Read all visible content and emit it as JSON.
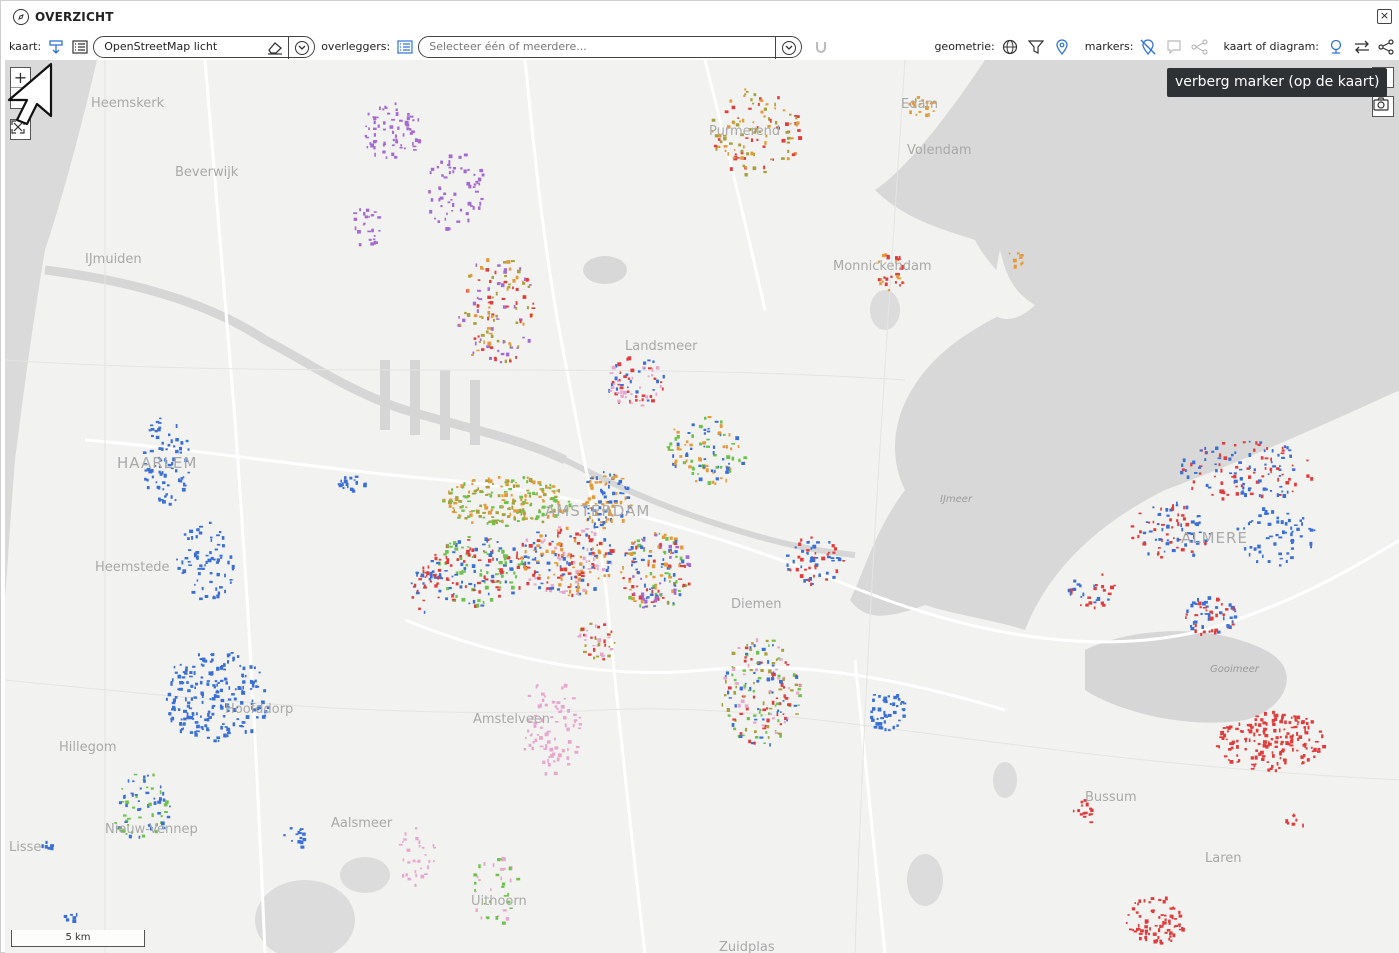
{
  "window": {
    "title": "OVERZICHT",
    "close_label": "×"
  },
  "toolbar": {
    "kaart_label": "kaart:",
    "basemap_value": "OpenStreetMap licht",
    "overlays_label": "overleggers:",
    "overlays_placeholder": "Selecteer één of meerdere...",
    "geometry_label": "geometrie:",
    "markers_label": "markers:",
    "map_or_chart_label": "kaart of diagram:"
  },
  "map": {
    "places": [
      {
        "name": "Heemskerk"
      },
      {
        "name": "Beverwijk"
      },
      {
        "name": "IJmuiden"
      },
      {
        "name": "HAARLEM"
      },
      {
        "name": "Heemstede"
      },
      {
        "name": "Hoofddorp"
      },
      {
        "name": "Hillegom"
      },
      {
        "name": "Nieuw-Vennep"
      },
      {
        "name": "Lisse"
      },
      {
        "name": "Aalsmeer"
      },
      {
        "name": "Amstelveen"
      },
      {
        "name": "Uithoorn"
      },
      {
        "name": "AMSTERDAM"
      },
      {
        "name": "Landsmeer"
      },
      {
        "name": "Purmerend"
      },
      {
        "name": "Edam"
      },
      {
        "name": "Volendam"
      },
      {
        "name": "Monnickendam"
      },
      {
        "name": "Diemen"
      },
      {
        "name": "ALMERE"
      },
      {
        "name": "Bussum"
      },
      {
        "name": "Laren"
      },
      {
        "name": "Zuidplas"
      }
    ],
    "water_labels": [
      {
        "name": "IJmeer"
      },
      {
        "name": "Gooimeer"
      }
    ],
    "scale_label": "5 km",
    "zoom_in": "+",
    "zoom_out": "−",
    "marker_colors": {
      "blue": "#3a6fd4",
      "green": "#6cc24a",
      "red": "#e03c3c",
      "orange": "#e59a3a",
      "purple": "#a56ad1",
      "pink": "#e7a6cc",
      "olive": "#a8a03a",
      "teal": "#2b9a7a"
    }
  },
  "tooltip": {
    "text": "verberg marker (op de kaart)"
  }
}
